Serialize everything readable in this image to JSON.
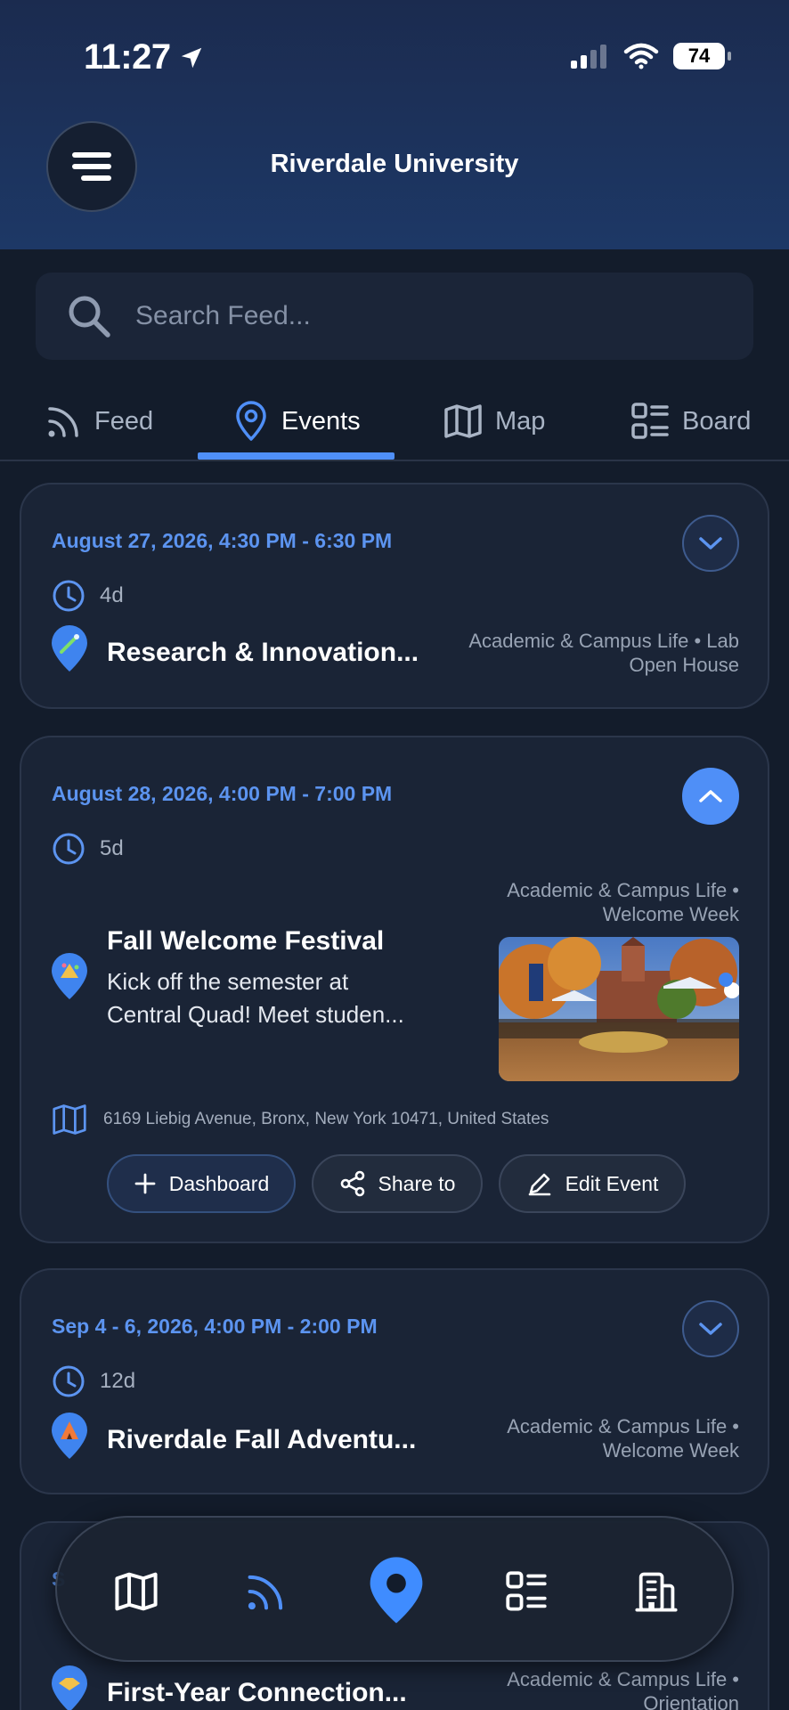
{
  "status_bar": {
    "time": "11:27",
    "battery": "74"
  },
  "header": {
    "title": "Riverdale University"
  },
  "search": {
    "placeholder": "Search Feed..."
  },
  "tabs": [
    {
      "label": "Feed",
      "icon": "rss-icon",
      "active": false
    },
    {
      "label": "Events",
      "icon": "location-pin-icon",
      "active": true
    },
    {
      "label": "Map",
      "icon": "map-icon",
      "active": false
    },
    {
      "label": "Board",
      "icon": "board-icon",
      "active": false
    }
  ],
  "events": [
    {
      "date": "August 27, 2026, 4:30 PM - 6:30 PM",
      "relative": "4d",
      "title": "Research & Innovation...",
      "category_line1": "Academic & Campus Life • Lab",
      "category_line2": "Open House",
      "expanded": false
    },
    {
      "date": "August 28, 2026, 4:00 PM - 7:00 PM",
      "relative": "5d",
      "title": "Fall Welcome Festival",
      "description_line1": "Kick off the semester at",
      "description_line2": "Central Quad! Meet studen...",
      "category_line1": "Academic & Campus Life •",
      "category_line2": "Welcome Week",
      "address": "6169 Liebig Avenue, Bronx, New York 10471, United States",
      "expanded": true,
      "actions": {
        "dashboard": "Dashboard",
        "share": "Share to",
        "edit": "Edit Event"
      }
    },
    {
      "date": "Sep 4 - 6, 2026, 4:00 PM - 2:00 PM",
      "relative": "12d",
      "title": "Riverdale Fall Adventu...",
      "category_line1": "Academic & Campus Life •",
      "category_line2": "Welcome Week",
      "expanded": false
    },
    {
      "date": "S",
      "title": "First-Year Connection...",
      "category_line1": "Academic & Campus Life •",
      "category_line2": "Orientation",
      "expanded": false
    }
  ],
  "bottom_nav": [
    "map-icon",
    "rss-icon",
    "location-pin-icon",
    "board-icon",
    "building-icon"
  ],
  "colors": {
    "accent": "#4f8ff7",
    "date_text": "#5c94f0",
    "background": "#131c2b",
    "card": "#1a2436"
  }
}
